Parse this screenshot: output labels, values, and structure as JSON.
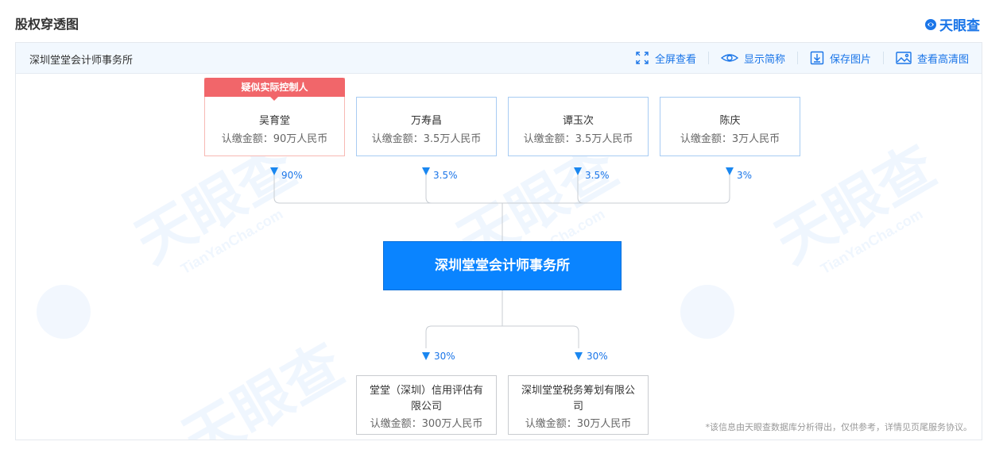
{
  "header": {
    "title": "股权穿透图",
    "brand": "天眼查",
    "brand_color": "#1a75e8"
  },
  "toolbar": {
    "company_name": "深圳堂堂会计师事务所",
    "tools": [
      {
        "label": "全屏查看",
        "icon": "fullscreen-icon"
      },
      {
        "label": "显示简称",
        "icon": "eye-icon"
      },
      {
        "label": "保存图片",
        "icon": "download-icon"
      },
      {
        "label": "查看高清图",
        "icon": "image-icon"
      }
    ]
  },
  "controller_tag": "疑似实际控制人",
  "shareholders": [
    {
      "name": "吴育堂",
      "amount": "认缴金额：90万人民币",
      "percent": "90%"
    },
    {
      "name": "万寿昌",
      "amount": "认缴金额：3.5万人民币",
      "percent": "3.5%"
    },
    {
      "name": "谭玉次",
      "amount": "认缴金额：3.5万人民币",
      "percent": "3.5%"
    },
    {
      "name": "陈庆",
      "amount": "认缴金额：3万人民币",
      "percent": "3%"
    }
  ],
  "main_company": "深圳堂堂会计师事务所",
  "subsidiaries": [
    {
      "name_line1": "堂堂（深圳）信用评估有",
      "name_line2": "限公司",
      "amount": "认缴金额：300万人民币",
      "percent": "30%"
    },
    {
      "name_line1": "深圳堂堂税务筹划有限公",
      "name_line2": "司",
      "amount": "认缴金额：30万人民币",
      "percent": "30%"
    }
  ],
  "disclaimer": "*该信息由天眼查数据库分析得出，仅供参考，详情见页尾服务协议。",
  "watermark_text": "天眼查",
  "watermark_sub": "TianYanCha.com",
  "colors": {
    "accent": "#1a75e8",
    "main_node": "#0a84ff",
    "controller_tag": "#f1666a",
    "line": "#c8cdd3"
  }
}
